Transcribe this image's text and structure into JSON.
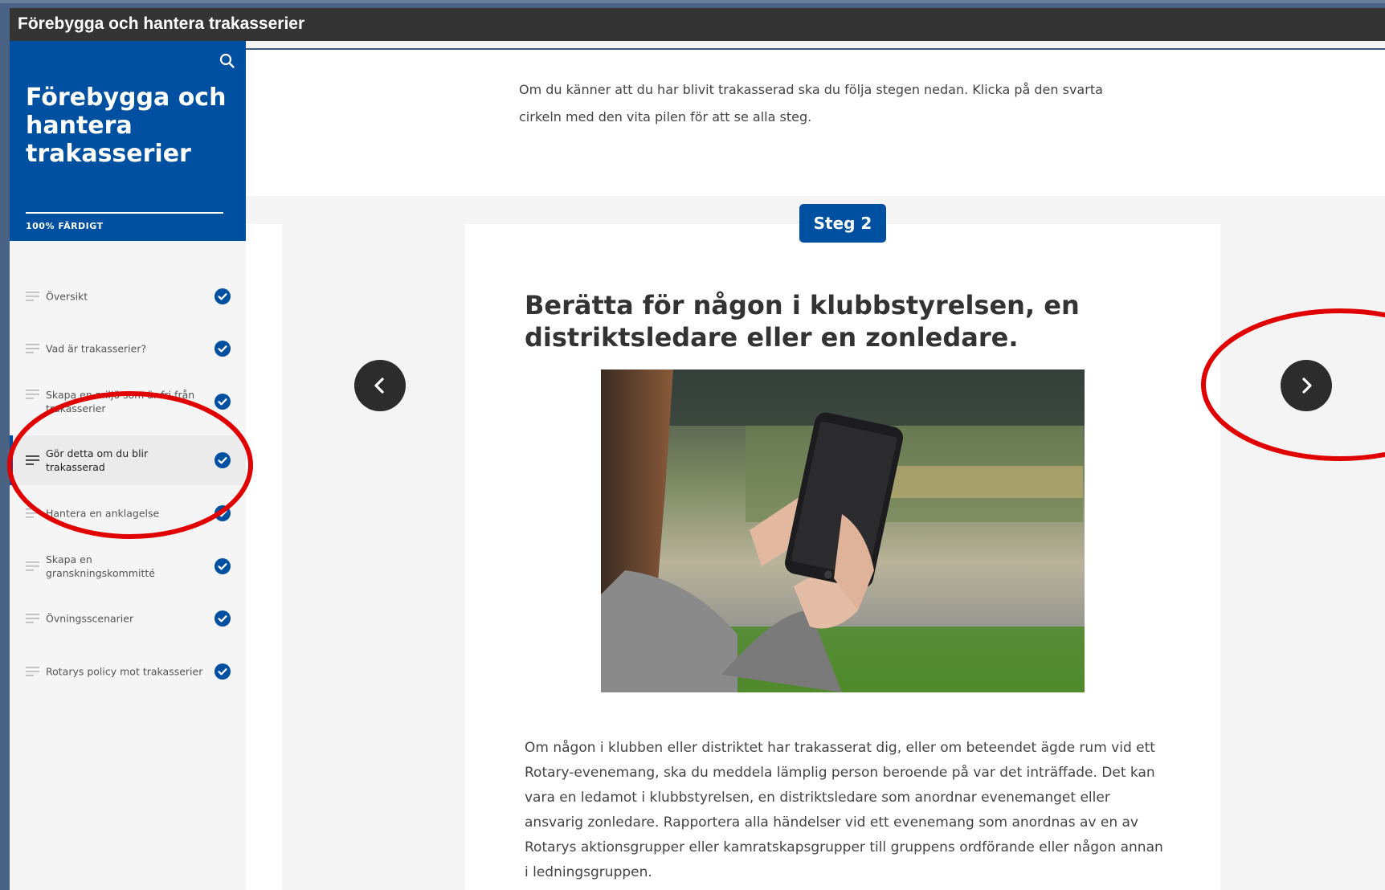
{
  "window": {
    "title": "Förebygga och hantera trakasserier"
  },
  "sidebar": {
    "course_title": "Förebygga och hantera trakasserier",
    "progress_label": "100% FÄRDIGT",
    "items": [
      {
        "label": "Översikt",
        "completed": true
      },
      {
        "label": "Vad är trakasserier?",
        "completed": true
      },
      {
        "label": "Skapa en miljö som är fri från trakasserier",
        "completed": true
      },
      {
        "label": "Gör detta om du blir trakasserad",
        "completed": true,
        "active": true
      },
      {
        "label": "Hantera en anklagelse",
        "completed": true
      },
      {
        "label": "Skapa en granskningskommitté",
        "completed": true
      },
      {
        "label": "Övningsscenarier",
        "completed": true
      },
      {
        "label": "Rotarys policy mot trakasserier",
        "completed": true
      }
    ]
  },
  "main": {
    "intro_text": "Om du känner att du har blivit trakasserad ska du följa stegen nedan. Klicka på den svarta cirkeln med den vita pilen för att se alla steg.",
    "step": {
      "badge": "Steg 2",
      "title": "Berätta för någon i klubbstyrelsen, en distriktsledare eller en zonledare.",
      "body": "Om någon i klubben eller distriktet har trakasserat dig, eller om beteendet ägde rum vid ett Rotary-evenemang, ska du meddela lämplig person beroende på var det inträffade. Det kan vara en ledamot i klubbstyrelsen, en distriktsledare som anordnar evenemanget eller ansvarig zonledare. Rapportera alla händelser vid ett evenemang som anordnas av en av Rotarys aktionsgrupper eller kamratskapsgrupper till gruppens ordförande eller någon annan i ledningsgruppen."
    },
    "navigation": {
      "prev_icon": "chevron-left-icon",
      "next_icon": "chevron-right-icon"
    }
  },
  "colors": {
    "brand_blue": "#0050a2",
    "annotation_red": "#e00000",
    "titlebar": "#343434"
  }
}
